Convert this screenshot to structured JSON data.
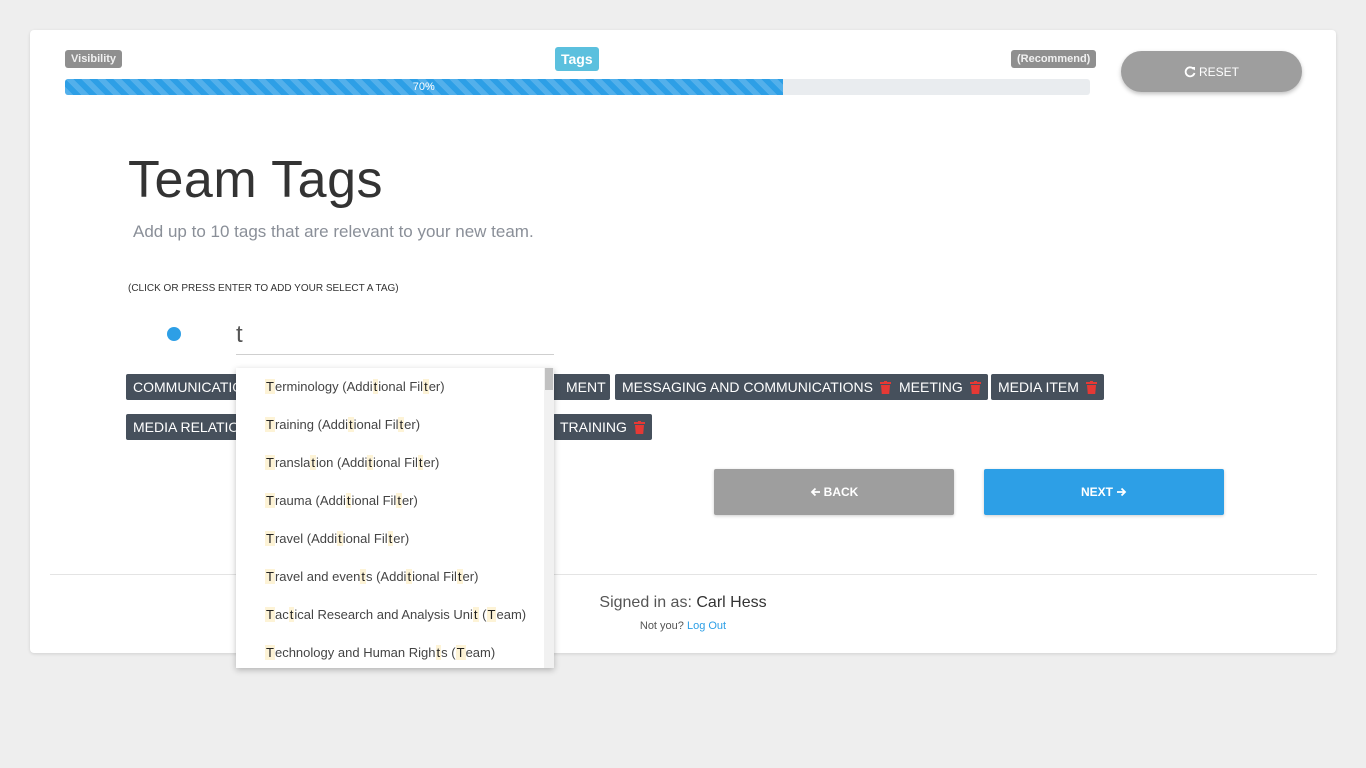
{
  "steps": {
    "visibility": "Visibility",
    "tags": "Tags",
    "recommend": "(Recommend)"
  },
  "progress": {
    "label": "70%",
    "value": 0.7
  },
  "reset_label": "RESET",
  "page": {
    "title": "Team Tags",
    "subtitle": "Add up to 10 tags that are relevant to your new team.",
    "hint": "(CLICK OR PRESS ENTER TO ADD YOUR SELECT A TAG)"
  },
  "input": {
    "value": "t"
  },
  "tags_row1": [
    "COMMUNICATIO",
    "MENT",
    "MESSAGING AND COMMUNICATIONS",
    "MEETING",
    "MEDIA ITEM"
  ],
  "tags_row2": [
    "MEDIA RELATIO",
    "TRAINING"
  ],
  "suggestions": [
    "Terminology (Additional Filter)",
    "Training (Additional Filter)",
    "Translation (Additional Filter)",
    "Trauma (Additional Filter)",
    "Travel (Additional Filter)",
    "Travel and events (Additional Filter)",
    "Tactical Research and Analysis Unit (Team)",
    "Technology and Human Rights (Team)"
  ],
  "nav": {
    "back": "BACK",
    "next": "NEXT"
  },
  "footer": {
    "signed_in_as": "Signed in as:",
    "user": "Carl Hess",
    "not_you": "Not you?",
    "logout": "Log Out"
  },
  "colors": {
    "accent": "#2d9fe6",
    "tag_bg": "#46505c",
    "trash": "#e53935",
    "grey_button": "#9e9e9e",
    "active_step": "#5bc0de"
  }
}
